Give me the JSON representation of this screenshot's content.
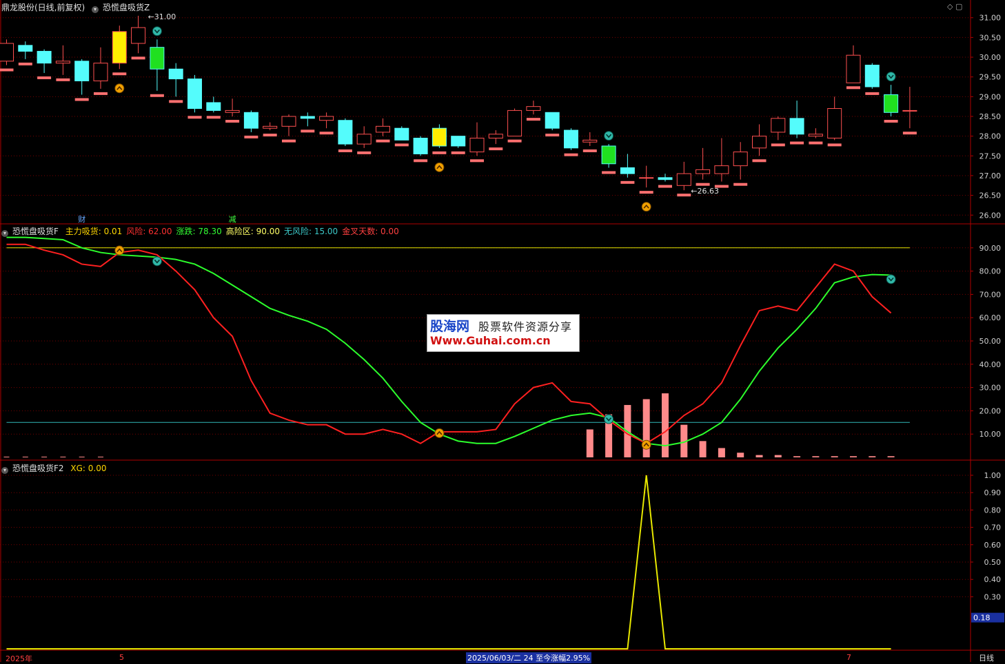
{
  "header_main": {
    "stock": "鼎龙股份(日线,前复权)",
    "indicator": "恐慌盘吸货Z"
  },
  "header_ind1": {
    "name": "恐慌盘吸货F",
    "items": [
      {
        "label": "主力吸货:",
        "value": "0.01",
        "color": "#ffd700"
      },
      {
        "label": "风险:",
        "value": "62.00",
        "color": "#ff3030"
      },
      {
        "label": "涨跌:",
        "value": "78.30",
        "color": "#33ff33"
      },
      {
        "label": "高险区:",
        "value": "90.00",
        "color": "#ffff66"
      },
      {
        "label": "无风险:",
        "value": "15.00",
        "color": "#3cc8c8"
      },
      {
        "label": "金叉天数:",
        "value": "0.00",
        "color": "#ff4040"
      }
    ]
  },
  "header_ind2": {
    "name": "恐慌盘吸货F2",
    "items": [
      {
        "label": "XG:",
        "value": "0.00",
        "color": "#ffd700"
      }
    ]
  },
  "price_axis": [
    "31.00",
    "30.50",
    "30.00",
    "29.50",
    "29.00",
    "28.50",
    "28.00",
    "27.50",
    "27.00",
    "26.50",
    "26.00"
  ],
  "ind1_axis": [
    "90.00",
    "80.00",
    "70.00",
    "60.00",
    "50.00",
    "40.00",
    "30.00",
    "20.00",
    "10.00"
  ],
  "ind2_axis": [
    "1.00",
    "0.90",
    "0.80",
    "0.70",
    "0.60",
    "0.50",
    "0.40",
    "0.30"
  ],
  "ind2_cursor_value": "0.18",
  "annotations": {
    "high_label": "31.00",
    "low_label": "26.63",
    "marker_cai": "财",
    "marker_jian": "减"
  },
  "bottom": {
    "year": "2025年",
    "month5": "5",
    "month7": "7",
    "cursor_info": "2025/06/03/二 24 至今涨幅2.95%",
    "period": "日线"
  },
  "watermark": {
    "line1": "股海网",
    "line1b": "股票软件资源分享",
    "line2": "Www.Guhai.com.cn"
  },
  "colors": {
    "up": "#ff5050",
    "down": "#54fcfc",
    "risk_line": "#ff2020",
    "trend_line": "#2cff2c",
    "high_zone": "#e8e800",
    "no_risk": "#30b8b8",
    "bars": "#ff8a8a",
    "grid": "#7a0000"
  },
  "chart_data": {
    "type": "candlestick",
    "candles": [
      [
        29.9,
        30.35,
        30.45,
        29.8
      ],
      [
        30.3,
        30.15,
        30.4,
        29.95
      ],
      [
        30.15,
        29.85,
        30.2,
        29.6
      ],
      [
        29.85,
        29.9,
        30.3,
        29.55
      ],
      [
        29.9,
        29.4,
        29.95,
        29.05
      ],
      [
        29.4,
        29.85,
        30.25,
        29.2
      ],
      [
        29.85,
        30.65,
        30.8,
        29.7
      ],
      [
        30.35,
        30.75,
        31.05,
        30.1
      ],
      [
        30.25,
        29.7,
        30.45,
        29.15
      ],
      [
        29.7,
        29.45,
        29.85,
        29.0
      ],
      [
        29.45,
        28.7,
        29.55,
        28.6
      ],
      [
        28.85,
        28.65,
        29.0,
        28.6
      ],
      [
        28.6,
        28.65,
        28.95,
        28.5
      ],
      [
        28.6,
        28.2,
        28.65,
        28.1
      ],
      [
        28.2,
        28.25,
        28.35,
        28.15
      ],
      [
        28.25,
        28.5,
        28.55,
        28.0
      ],
      [
        28.5,
        28.45,
        28.6,
        28.25
      ],
      [
        28.4,
        28.5,
        28.6,
        28.2
      ],
      [
        28.4,
        27.8,
        28.45,
        27.75
      ],
      [
        27.8,
        28.05,
        28.25,
        27.7
      ],
      [
        28.1,
        28.25,
        28.45,
        28.0
      ],
      [
        28.2,
        27.9,
        28.25,
        27.9
      ],
      [
        27.95,
        27.55,
        28.0,
        27.5
      ],
      [
        28.2,
        27.75,
        28.3,
        27.7
      ],
      [
        28.0,
        27.75,
        28.0,
        27.7
      ],
      [
        27.6,
        27.95,
        28.35,
        27.5
      ],
      [
        27.95,
        28.05,
        28.15,
        27.8
      ],
      [
        28.0,
        28.65,
        28.7,
        28.0
      ],
      [
        28.65,
        28.75,
        28.9,
        28.55
      ],
      [
        28.6,
        28.2,
        28.6,
        28.15
      ],
      [
        28.15,
        27.7,
        28.2,
        27.65
      ],
      [
        27.85,
        27.9,
        28.1,
        27.75
      ],
      [
        27.75,
        27.3,
        27.8,
        27.2
      ],
      [
        27.2,
        27.05,
        27.55,
        26.95
      ],
      [
        26.95,
        26.95,
        27.25,
        26.7
      ],
      [
        26.95,
        26.9,
        27.05,
        26.85
      ],
      [
        26.75,
        27.05,
        27.35,
        26.63
      ],
      [
        27.05,
        27.15,
        27.7,
        26.9
      ],
      [
        27.05,
        27.25,
        27.95,
        26.85
      ],
      [
        27.25,
        27.6,
        27.85,
        26.9
      ],
      [
        27.7,
        28.0,
        28.3,
        27.5
      ],
      [
        28.1,
        28.45,
        28.5,
        27.9
      ],
      [
        28.45,
        28.05,
        28.9,
        27.95
      ],
      [
        28.0,
        28.05,
        28.2,
        27.95
      ],
      [
        27.95,
        28.7,
        29.0,
        27.9
      ],
      [
        29.35,
        30.05,
        30.3,
        29.35
      ],
      [
        29.8,
        29.25,
        29.85,
        29.2
      ],
      [
        29.05,
        28.6,
        29.3,
        28.5
      ],
      [
        28.65,
        28.65,
        29.25,
        28.2
      ]
    ],
    "risk": [
      91.5,
      91.5,
      89,
      87,
      83,
      82,
      88,
      89,
      87,
      80,
      72,
      60,
      52,
      33,
      19,
      16,
      14,
      14,
      10,
      10,
      12,
      10,
      6,
      11,
      11,
      11,
      12,
      23,
      30,
      32,
      24,
      23,
      16,
      10,
      6,
      11,
      18,
      23,
      32,
      48,
      63,
      65,
      63,
      73,
      83,
      80,
      69,
      62
    ],
    "trend": [
      94.5,
      94.5,
      94,
      93.5,
      90,
      88,
      87,
      86.5,
      86,
      85,
      83,
      79,
      74,
      69,
      64,
      61,
      58.5,
      55,
      49,
      42,
      34,
      24,
      15,
      10,
      7,
      6,
      6,
      9,
      12.5,
      16,
      18,
      19,
      17,
      11,
      6,
      5,
      6.5,
      10,
      15,
      25,
      37,
      47,
      55,
      64,
      75,
      77.5,
      78.5,
      78.3
    ],
    "bars": [
      0,
      0,
      0,
      0,
      0,
      0,
      0,
      0,
      0,
      0,
      0,
      0,
      0,
      0,
      0,
      0,
      0,
      0,
      0,
      0,
      0,
      0,
      0,
      0,
      0,
      0,
      0,
      0,
      0,
      0,
      0,
      12,
      18.5,
      22.5,
      25,
      27.5,
      14,
      7,
      4,
      2,
      1,
      1,
      0.5,
      0.5,
      0.5,
      0.5,
      0.5,
      0.5
    ],
    "xg": [
      0,
      0,
      0,
      0,
      0,
      0,
      0,
      0,
      0,
      0,
      0,
      0,
      0,
      0,
      0,
      0,
      0,
      0,
      0,
      0,
      0,
      0,
      0,
      0,
      0,
      0,
      0,
      0,
      0,
      0,
      0,
      0,
      0,
      0,
      1,
      0,
      0,
      0,
      0,
      0,
      0,
      0,
      0,
      0,
      0,
      0,
      0,
      0
    ],
    "high_zone": 90,
    "no_risk": 15,
    "up_marks": [
      6,
      23,
      34
    ],
    "down_marks_price": [
      8,
      32,
      47
    ],
    "up_marks_ind": [
      6,
      23,
      34
    ],
    "down_marks_ind": [
      8,
      32,
      47
    ],
    "yellow_bars": [
      6,
      23
    ],
    "green_bars": [
      8,
      32,
      47
    ],
    "high_idx": 7,
    "low_idx": 36,
    "cai_idx": 4,
    "jian_idx": 12
  }
}
